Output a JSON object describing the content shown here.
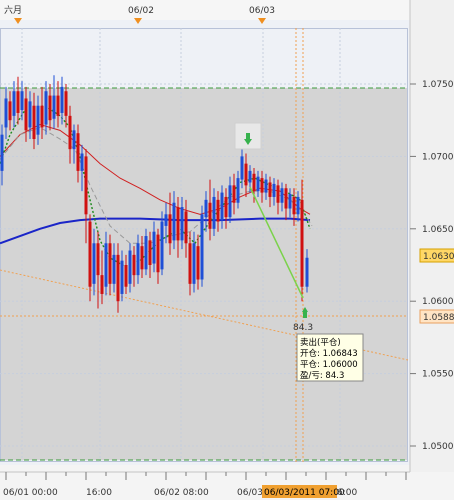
{
  "top_axis": {
    "labels": [
      {
        "text": "六月",
        "x": 0.03
      },
      {
        "text": "06/02",
        "x": 0.305
      },
      {
        "text": "06/03",
        "x": 0.57
      }
    ]
  },
  "bottom_axis": {
    "labels": [
      {
        "text": "06/01 00:00"
      },
      {
        "text": "16:00"
      },
      {
        "text": "06/02 08:00"
      },
      {
        "text": "06/03"
      },
      {
        "text": "06/03/2011 07:00"
      },
      {
        "text": "6:00"
      }
    ],
    "highlight_label": "06/03/2011 07:00"
  },
  "price_axis": {
    "ticks": [
      "1.0750",
      "1.0700",
      "1.0650",
      "1.0600",
      "1.0550",
      "1.0500"
    ],
    "current_price": "1.06306",
    "level_price": "1.05884"
  },
  "trade": {
    "pips_label": "84.3",
    "tooltip": {
      "line1": "卖出(平仓)",
      "line2": "开仓: 1.06843",
      "line3": "平仓: 1.06000",
      "line4": "盈/亏: 84.3"
    }
  },
  "colors": {
    "up_candle": "#1f4fd6",
    "down_candle": "#d01010",
    "ma_long": "#1a25c8",
    "ma_red": "#d02020",
    "ma_gray": "#9a9a9a",
    "ma_green": "#1c8a1c",
    "trade_line": "#7bd24b",
    "trend_line": "#f0a050",
    "dashed_level": "#3c9a3c"
  }
}
